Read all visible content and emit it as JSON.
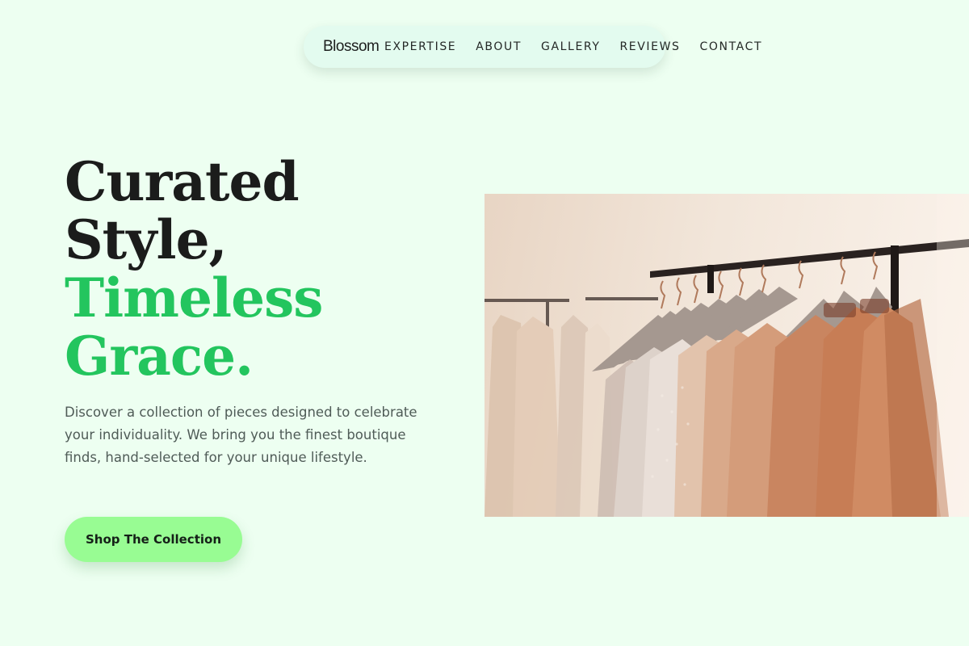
{
  "brand": {
    "name": "Blossom"
  },
  "nav": {
    "links": [
      {
        "label": "EXPERTISE"
      },
      {
        "label": "ABOUT"
      },
      {
        "label": "GALLERY"
      },
      {
        "label": "REVIEWS"
      },
      {
        "label": "CONTACT"
      }
    ]
  },
  "hero": {
    "headline_line1": "Curated",
    "headline_line2": "Style,",
    "headline_line3": "Timeless",
    "headline_line4": "Grace.",
    "description": "Discover a collection of pieces designed to celebrate your individuality. We bring you the finest boutique finds, hand-selected for your unique lifestyle.",
    "cta_label": "Shop The Collection",
    "image_alt": "Clothing rack with blush and peach dresses on velvet hangers"
  },
  "colors": {
    "page_background": "#edfff1",
    "nav_background": "#e3fbef",
    "accent_green": "#23c55e",
    "cta_background": "#98fc93",
    "heading_text": "#1b1c1b",
    "body_text": "#4f5b57"
  }
}
